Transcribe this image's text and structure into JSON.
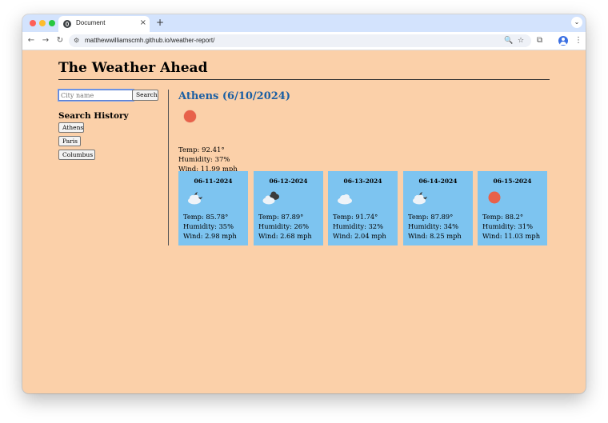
{
  "browser": {
    "tab_title": "Document",
    "tab_close": "×",
    "new_tab": "+",
    "tab_menu": "⌄",
    "url": "matthewwilliamscmh.github.io/weather-report/",
    "nav": {
      "back": "←",
      "forward": "→",
      "reload": "↻"
    },
    "site_icon": "⚙",
    "omni_icons": {
      "zoom": "🔍",
      "bookmark": "☆"
    },
    "toolbar_icons": {
      "extensions": "⧉",
      "menu": "⋮"
    }
  },
  "page": {
    "title": "The Weather Ahead",
    "search": {
      "placeholder": "City name",
      "value": "",
      "button": "Search"
    },
    "history": {
      "heading": "Search History",
      "items": [
        "Athens",
        "Paris",
        "Columbus"
      ]
    },
    "current": {
      "heading": "Athens (6/10/2024)",
      "icon": "sun-icon",
      "temp": "Temp: 92.41°",
      "humidity": "Humidity: 37%",
      "wind": "Wind: 11.99 mph"
    },
    "forecast": [
      {
        "date": "06-11-2024",
        "icon": "partly-cloudy-night-icon",
        "temp": "Temp: 85.78°",
        "humidity": "Humidity: 35%",
        "wind": "Wind: 2.98 mph"
      },
      {
        "date": "06-12-2024",
        "icon": "broken-clouds-icon",
        "temp": "Temp: 87.89°",
        "humidity": "Humidity: 26%",
        "wind": "Wind: 2.68 mph"
      },
      {
        "date": "06-13-2024",
        "icon": "cloud-icon",
        "temp": "Temp: 91.74°",
        "humidity": "Humidity: 32%",
        "wind": "Wind: 2.04 mph"
      },
      {
        "date": "06-14-2024",
        "icon": "partly-cloudy-night-icon",
        "temp": "Temp: 87.89°",
        "humidity": "Humidity: 34%",
        "wind": "Wind: 8.25 mph"
      },
      {
        "date": "06-15-2024",
        "icon": "sun-icon",
        "temp": "Temp: 88.2°",
        "humidity": "Humidity: 31%",
        "wind": "Wind: 11.03 mph"
      }
    ]
  },
  "colors": {
    "page_background": "#fbd0a9",
    "card_background": "#7dc4f0",
    "city_heading": "#1b5fa3",
    "sun": "#e8614a",
    "tabstrip": "#d3e3fd"
  }
}
